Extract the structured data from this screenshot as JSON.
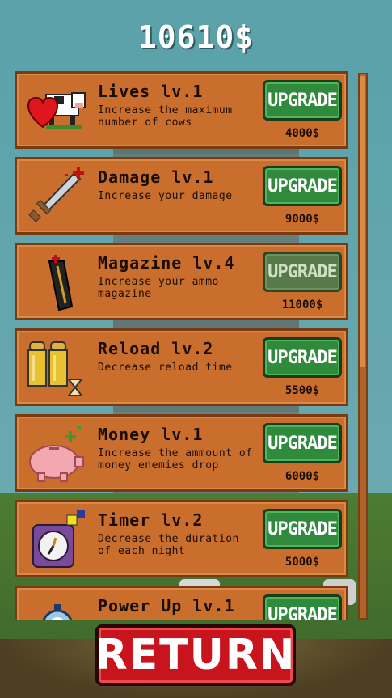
{
  "money": "10610$",
  "items": [
    {
      "title": "Lives lv.1",
      "desc": "Increase the maximum number of cows",
      "button": "UPGRADE",
      "price": "4000$",
      "enabled": true,
      "icon": "cow-heart-icon"
    },
    {
      "title": "Damage lv.1",
      "desc": "Increase your damage",
      "button": "UPGRADE",
      "price": "9000$",
      "enabled": true,
      "icon": "sword-icon"
    },
    {
      "title": "Magazine lv.4",
      "desc": "Increase your ammo magazine",
      "button": "UPGRADE",
      "price": "11000$",
      "enabled": false,
      "icon": "magazine-icon"
    },
    {
      "title": "Reload lv.2",
      "desc": "Decrease reload time",
      "button": "UPGRADE",
      "price": "5500$",
      "enabled": true,
      "icon": "bullets-hourglass-icon"
    },
    {
      "title": "Money lv.1",
      "desc": "Increase the ammount of money enemies drop",
      "button": "UPGRADE",
      "price": "6000$",
      "enabled": true,
      "icon": "piggy-bank-icon"
    },
    {
      "title": "Timer lv.2",
      "desc": "Decrease the duration of each night",
      "button": "UPGRADE",
      "price": "5000$",
      "enabled": true,
      "icon": "clock-icon"
    },
    {
      "title": "Power Up lv.1",
      "desc": "",
      "button": "UPGRADE",
      "price": "",
      "enabled": true,
      "icon": "stopwatch-icon"
    }
  ],
  "return_label": "RETURN"
}
